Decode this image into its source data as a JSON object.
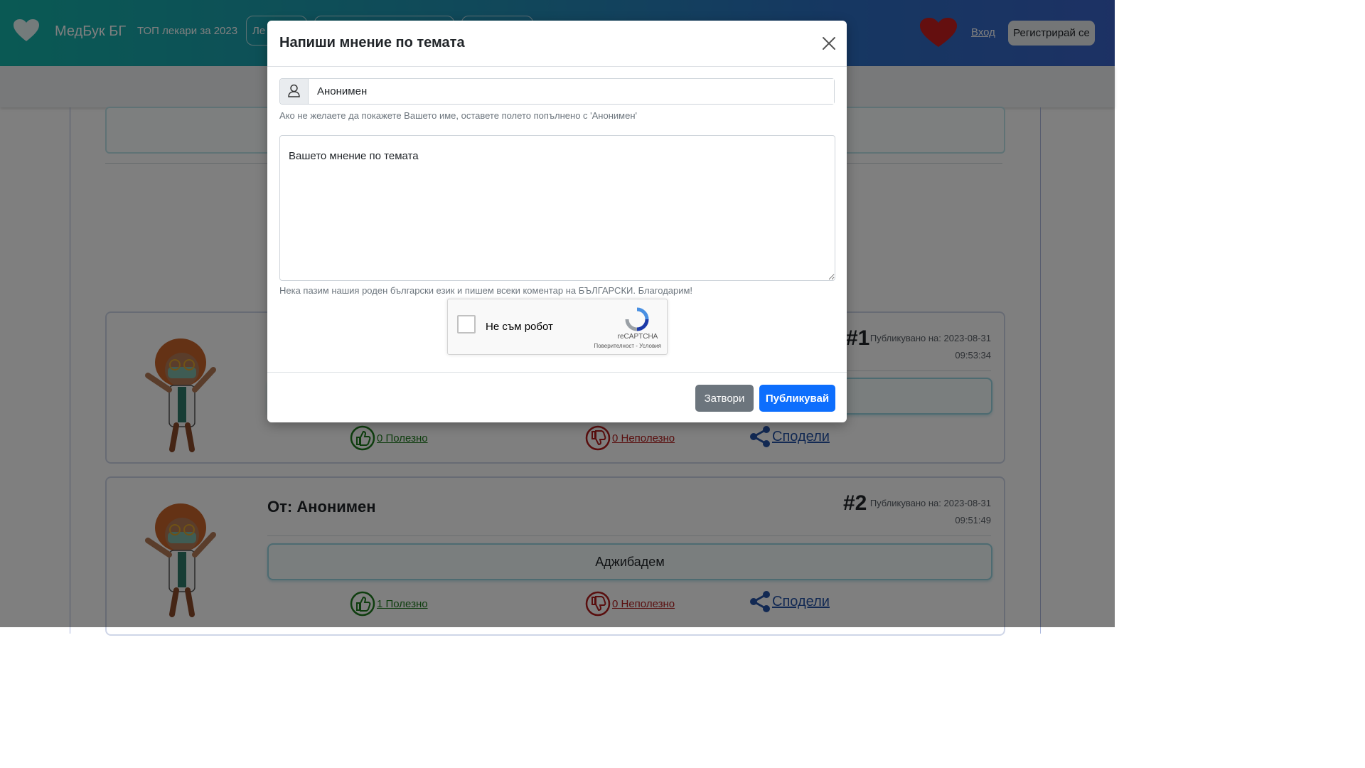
{
  "header": {
    "brand": "МедБук БГ",
    "top_doctors": "ТОП лекари за 2023",
    "pill_partial": "Ле",
    "login": "Вход",
    "register": "Регистрирай се"
  },
  "comments": [
    {
      "number": "#1",
      "published_label": "Публикувано на: 2023-08-31",
      "published_time": "09:53:34",
      "useful": "0 Полезно",
      "not_useful": "0 Неполезно",
      "share": "Сподели"
    },
    {
      "author": "От: Анонимен",
      "number": "#2",
      "published_label": "Публикувано на: 2023-08-31",
      "published_time": "09:51:49",
      "text": "Аджибадем",
      "useful": "1 Полезно",
      "not_useful": "0 Неполезно",
      "share": "Сподели"
    }
  ],
  "modal": {
    "title": "Напиши мнение по темата",
    "name_value": "Анонимен",
    "name_help": "Ако не желаете да покажете Вашето име, оставете полето попълнено с 'Анонимен'",
    "opinion_placeholder": "Вашето мнение по темата",
    "opinion_help": "Нека пазим нашия роден български език и пишем всеки коментар на БЪЛГАРСКИ. Благодарим!",
    "recaptcha": {
      "label": "Не съм робот",
      "brand": "reCAPTCHA",
      "links": "Поверителност - Условия"
    },
    "close_button": "Затвори",
    "publish_button": "Публикувай"
  },
  "colors": {
    "header_gradient_start": "#14b3a8",
    "header_gradient_end": "#3a63c8",
    "primary": "#0d6efd",
    "secondary": "#6c757d",
    "useful": "#1d7a1d",
    "not_useful": "#b31d1d",
    "share": "#2452a6"
  }
}
